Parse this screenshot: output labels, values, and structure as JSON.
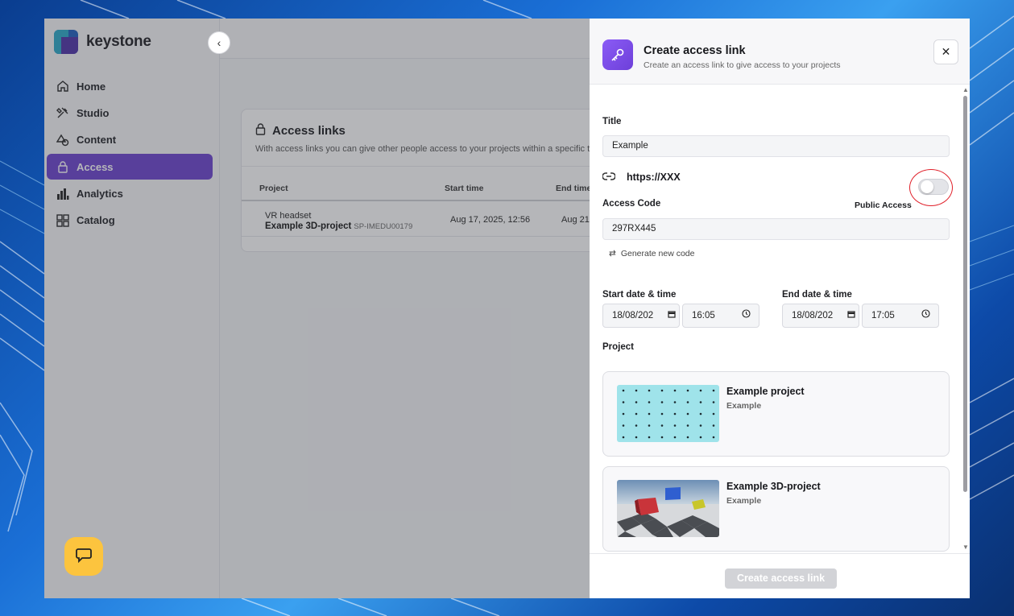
{
  "app": {
    "name": "keystone"
  },
  "sidebar": {
    "items": [
      {
        "label": "Home",
        "icon": "home-icon"
      },
      {
        "label": "Studio",
        "icon": "tools-icon"
      },
      {
        "label": "Content",
        "icon": "shapes-icon"
      },
      {
        "label": "Access",
        "icon": "lock-icon",
        "active": true
      },
      {
        "label": "Analytics",
        "icon": "bar-chart-icon"
      },
      {
        "label": "Catalog",
        "icon": "grid-icon"
      }
    ]
  },
  "access_card": {
    "title": "Access links",
    "subtitle": "With access links you can give other people access to your projects within a specific t",
    "columns": [
      "Project",
      "Start time",
      "End time"
    ],
    "rows": [
      {
        "category": "VR headset",
        "name": "Example 3D-project",
        "code": "SP-IMEDU00179",
        "start": "Aug 17, 2025, 12:56",
        "end": "Aug 21"
      }
    ]
  },
  "drawer": {
    "title": "Create access link",
    "subtitle": "Create an access link to give access to your projects",
    "title_label": "Title",
    "title_value": "Example",
    "url": "https://XXX",
    "access_code_label": "Access Code",
    "public_access_label": "Public Access",
    "public_access_on": false,
    "access_code_value": "297RX445",
    "generate_label": "Generate new code",
    "start_label": "Start date & time",
    "start_date": "18/08/202",
    "start_time": "16:05",
    "end_label": "End date & time",
    "end_date": "18/08/202",
    "end_time": "17:05",
    "project_label": "Project",
    "projects": [
      {
        "title": "Example project",
        "subtitle": "Example"
      },
      {
        "title": "Example 3D-project",
        "subtitle": "Example"
      }
    ],
    "create_button": "Create access link"
  },
  "colors": {
    "accent": "#6a3fcf",
    "chat": "#fcc43e",
    "highlight": "#e0202a"
  }
}
